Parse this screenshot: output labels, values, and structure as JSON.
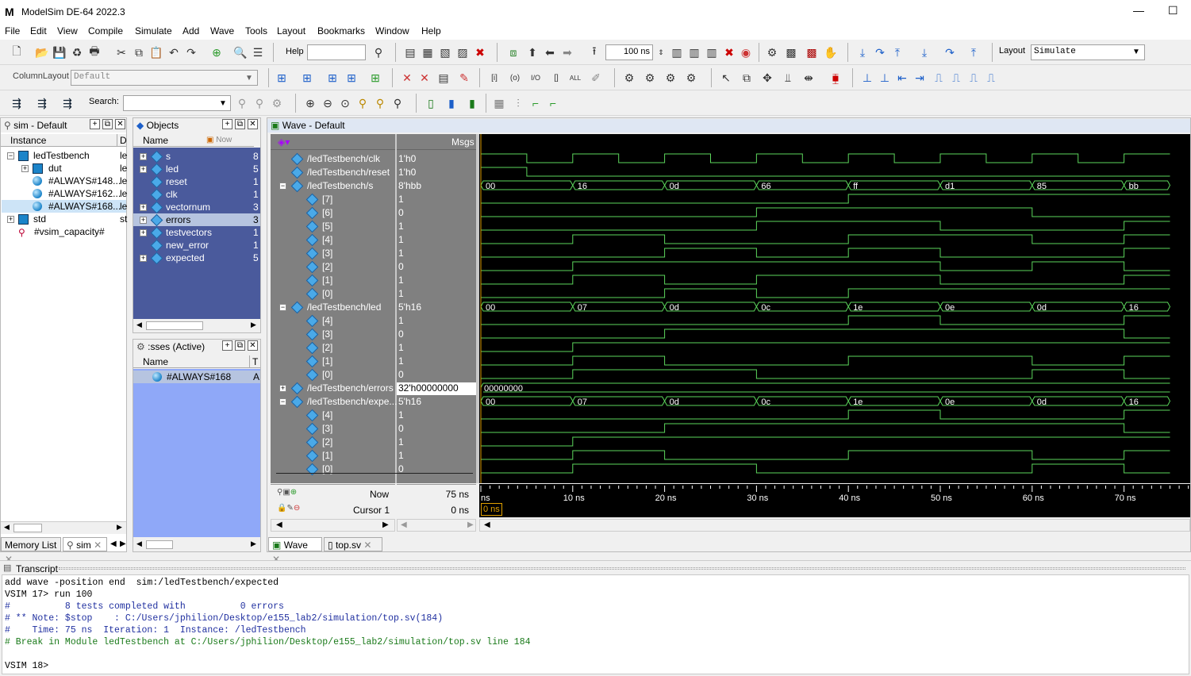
{
  "window": {
    "title": "ModelSim DE-64 2022.3",
    "minimize": "—",
    "maximize": "☐"
  },
  "menu": [
    "File",
    "Edit",
    "View",
    "Compile",
    "Simulate",
    "Add",
    "Wave",
    "Tools",
    "Layout",
    "Bookmarks",
    "Window",
    "Help"
  ],
  "toolbar": {
    "help_label": "Help",
    "run_length": "100 ns",
    "layout_label": "Layout",
    "layout_value": "Simulate",
    "column_layout_label": "ColumnLayout",
    "column_layout_value": "Default",
    "search_label": "Search:"
  },
  "sim_pane": {
    "title": "sim - Default",
    "col_instance": "Instance",
    "col_d": "D",
    "items": [
      {
        "name": "ledTestbench",
        "d": "le"
      },
      {
        "name": "dut",
        "d": "le"
      },
      {
        "name": "#ALWAYS#148...",
        "d": "le"
      },
      {
        "name": "#ALWAYS#162...",
        "d": "le"
      },
      {
        "name": "#ALWAYS#168...",
        "d": "le"
      },
      {
        "name": "std",
        "d": "st"
      },
      {
        "name": "#vsim_capacity#",
        "d": ""
      }
    ],
    "tabs": [
      "Memory List",
      "sim"
    ]
  },
  "objects_pane": {
    "title": "Objects",
    "col_name": "Name",
    "col_now": "Now",
    "items": [
      {
        "name": "s",
        "v": "8"
      },
      {
        "name": "led",
        "v": "5"
      },
      {
        "name": "reset",
        "v": "1"
      },
      {
        "name": "clk",
        "v": "1"
      },
      {
        "name": "vectornum",
        "v": "3"
      },
      {
        "name": "errors",
        "v": "3"
      },
      {
        "name": "testvectors",
        "v": "1"
      },
      {
        "name": "new_error",
        "v": "1"
      },
      {
        "name": "expected",
        "v": "5"
      }
    ]
  },
  "processes_pane": {
    "title": ":sses (Active)",
    "col_name": "Name",
    "col_t": "T",
    "items": [
      {
        "name": "#ALWAYS#168",
        "t": "A"
      }
    ]
  },
  "wave": {
    "title": "Wave - Default",
    "msgs": "Msgs",
    "signals": [
      {
        "name": "/ledTestbench/clk",
        "val": "1'h0"
      },
      {
        "name": "/ledTestbench/reset",
        "val": "1'h0"
      },
      {
        "name": "/ledTestbench/s",
        "val": "8'hbb"
      },
      {
        "name": "[7]",
        "val": "1"
      },
      {
        "name": "[6]",
        "val": "0"
      },
      {
        "name": "[5]",
        "val": "1"
      },
      {
        "name": "[4]",
        "val": "1"
      },
      {
        "name": "[3]",
        "val": "1"
      },
      {
        "name": "[2]",
        "val": "0"
      },
      {
        "name": "[1]",
        "val": "1"
      },
      {
        "name": "[0]",
        "val": "1"
      },
      {
        "name": "/ledTestbench/led",
        "val": "5'h16"
      },
      {
        "name": "[4]",
        "val": "1"
      },
      {
        "name": "[3]",
        "val": "0"
      },
      {
        "name": "[2]",
        "val": "1"
      },
      {
        "name": "[1]",
        "val": "1"
      },
      {
        "name": "[0]",
        "val": "0"
      },
      {
        "name": "/ledTestbench/errors",
        "val": "32'h00000000"
      },
      {
        "name": "/ledTestbench/expe...",
        "val": "5'h16"
      },
      {
        "name": "[4]",
        "val": "1"
      },
      {
        "name": "[3]",
        "val": "0"
      },
      {
        "name": "[2]",
        "val": "1"
      },
      {
        "name": "[1]",
        "val": "1"
      },
      {
        "name": "[0]",
        "val": "0"
      }
    ],
    "s_bus": [
      "00",
      "16",
      "0d",
      "66",
      "ff",
      "d1",
      "85",
      "bb"
    ],
    "led_bus": [
      "00",
      "07",
      "0d",
      "0c",
      "1e",
      "0e",
      "0d",
      "16"
    ],
    "errors_bus": "00000000",
    "now_label": "Now",
    "now_value": "75 ns",
    "cursor_label": "Cursor 1",
    "cursor_value": "0 ns",
    "cursor_tag": "0 ns",
    "ticks": [
      "ns",
      "10 ns",
      "20 ns",
      "30 ns",
      "40 ns",
      "50 ns",
      "60 ns",
      "70 ns"
    ],
    "tabs": [
      "Wave",
      "top.sv"
    ]
  },
  "transcript": {
    "title": "Transcript",
    "lines": [
      {
        "t": "add wave -position end  sim:/ledTestbench/expected",
        "c": "k"
      },
      {
        "t": "VSIM 17> run 100",
        "c": "k"
      },
      {
        "t": "#          8 tests completed with          0 errors",
        "c": "b"
      },
      {
        "t": "# ** Note: $stop    : C:/Users/jphilion/Desktop/e155_lab2/simulation/top.sv(184)",
        "c": "b"
      },
      {
        "t": "#    Time: 75 ns  Iteration: 1  Instance: /ledTestbench",
        "c": "b"
      },
      {
        "t": "# Break in Module ledTestbench at C:/Users/jphilion/Desktop/e155_lab2/simulation/top.sv line 184",
        "c": "g"
      },
      {
        "t": "",
        "c": "k"
      },
      {
        "t": "VSIM 18>",
        "c": "k"
      }
    ]
  }
}
